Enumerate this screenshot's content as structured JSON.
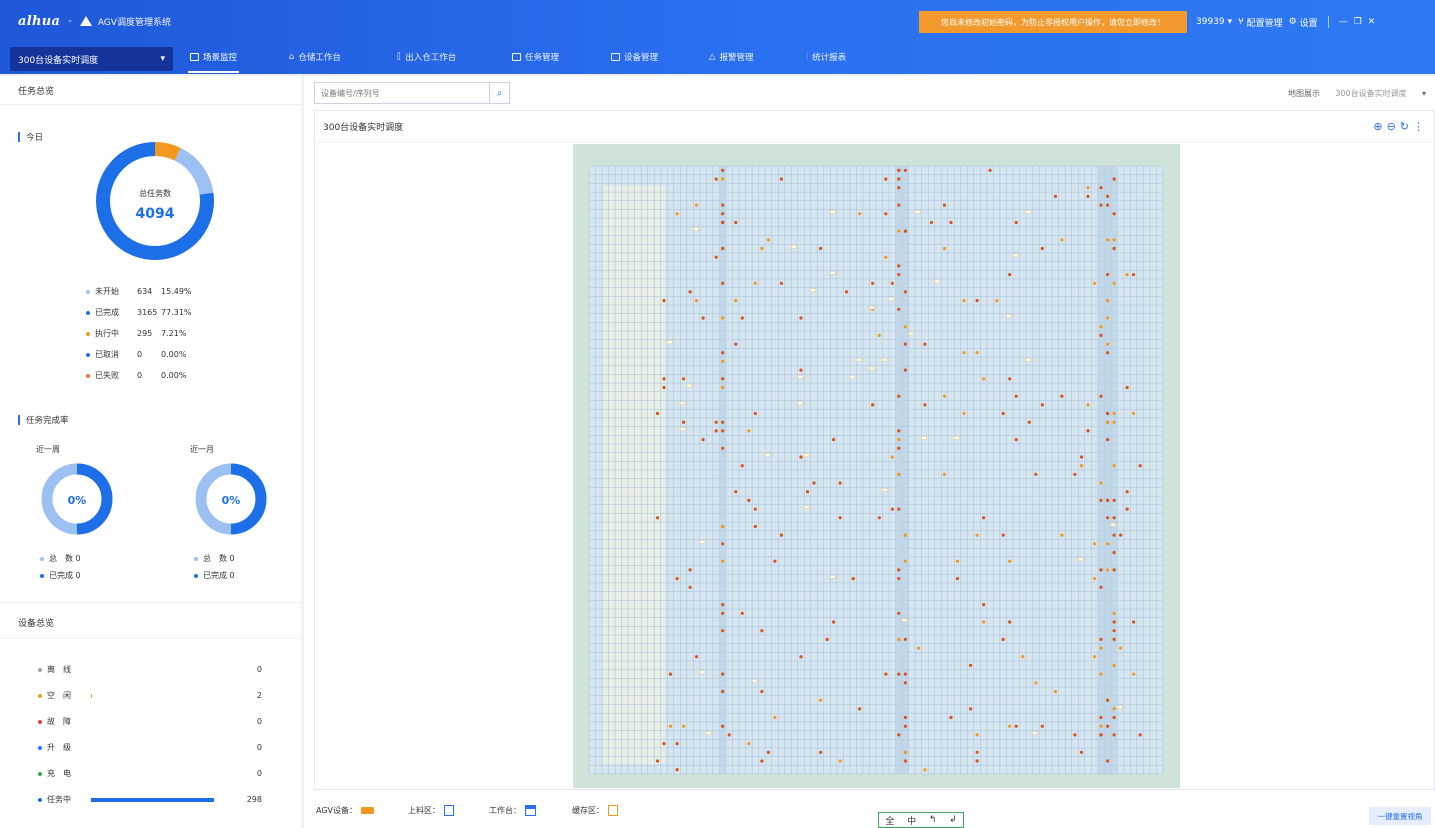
{
  "app": {
    "brand": "alhua",
    "system_title": "AGV调度管理系统",
    "warning_banner": "您尚未修改初始密码，为防止非授权用户操作，请您立即修改！",
    "user_id": "39939",
    "config_label": "配置管理",
    "settings_label": "设置"
  },
  "nav": {
    "scene_selector": "300台设备实时调度",
    "items": [
      {
        "label": "场景监控",
        "icon": "monitor-icon"
      },
      {
        "label": "仓储工作台",
        "icon": "home-icon"
      },
      {
        "label": "出入仓工作台",
        "icon": "bracket-icon"
      },
      {
        "label": "任务管理",
        "icon": "task-icon"
      },
      {
        "label": "设备管理",
        "icon": "device-icon"
      },
      {
        "label": "报警管理",
        "icon": "bell-icon"
      },
      {
        "label": "统计报表",
        "icon": "chart-icon"
      }
    ]
  },
  "task_overview": {
    "title": "任务总览",
    "today_label": "今日",
    "total_label": "总任务数",
    "total_value": "4094",
    "legend": [
      {
        "label": "未开始",
        "count": "634",
        "pct": "15.49%",
        "color": "#9dc0f2",
        "fraction": 0.1549
      },
      {
        "label": "已完成",
        "count": "3165",
        "pct": "77.31%",
        "color": "#1d6fe8",
        "fraction": 0.7731
      },
      {
        "label": "执行中",
        "count": "295",
        "pct": "7.21%",
        "color": "#f39a1e",
        "fraction": 0.0721
      },
      {
        "label": "已取消",
        "count": "0",
        "pct": "0.00%",
        "color": "#2a6ff0",
        "fraction": 0
      },
      {
        "label": "已失败",
        "count": "0",
        "pct": "0.00%",
        "color": "#f0762a",
        "fraction": 0
      }
    ],
    "completion_title": "任务完成率",
    "week": {
      "label": "近一周",
      "pct": "0%",
      "total_label": "总　数",
      "total": "0",
      "done_label": "已完成",
      "done": "0"
    },
    "month": {
      "label": "近一月",
      "pct": "0%",
      "total_label": "总　数",
      "total": "0",
      "done_label": "已完成",
      "done": "0"
    }
  },
  "device_overview": {
    "title": "设备总览",
    "rows": [
      {
        "label": "离　线",
        "value": "0",
        "color": "#9aa3b5",
        "fraction": 0
      },
      {
        "label": "空　闲",
        "value": "2",
        "color": "#f39a1e",
        "fraction": 0.007
      },
      {
        "label": "故　障",
        "value": "0",
        "color": "#e04040",
        "fraction": 0
      },
      {
        "label": "升　级",
        "value": "0",
        "color": "#2a6ff0",
        "fraction": 0
      },
      {
        "label": "充　电",
        "value": "0",
        "color": "#3aa55a",
        "fraction": 0
      },
      {
        "label": "任务中",
        "value": "298",
        "color": "#1d6fe8",
        "fraction": 0.993
      }
    ]
  },
  "main": {
    "search_placeholder": "设备编号/序列号",
    "map_label": "地图展示",
    "map_select": "300台设备实时调度",
    "panel_title": "300台设备实时调度",
    "legend": {
      "agv": "AGV设备：",
      "feed": "上料区：",
      "station": "工作台：",
      "buffer": "缓存区："
    },
    "compass": [
      "全",
      "中",
      "↰",
      "↲"
    ],
    "one_key": "一键重置视角"
  }
}
